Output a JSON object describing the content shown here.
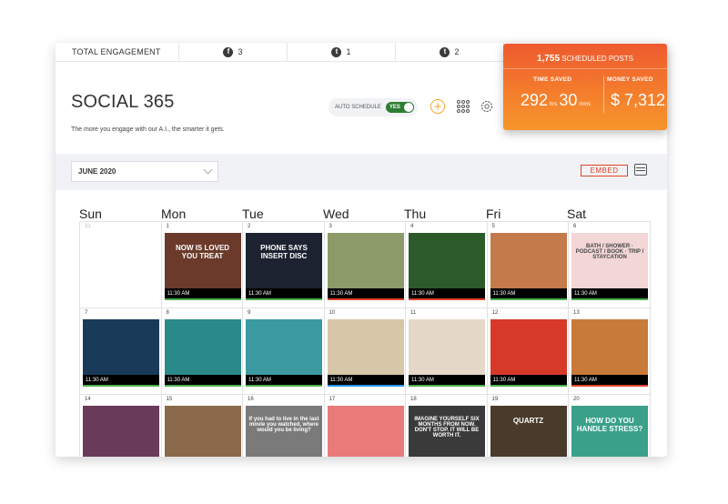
{
  "stats": {
    "label": "TOTAL ENGAGEMENT",
    "networks": [
      {
        "icon": "facebook-icon",
        "glyph": "f",
        "count": "3"
      },
      {
        "icon": "twitter-icon",
        "glyph": "t",
        "count": "1"
      },
      {
        "icon": "tumblr-icon",
        "glyph": "t",
        "count": "2"
      }
    ]
  },
  "header": {
    "title": "SOCIAL 365",
    "subtitle": "The more you engage with our A.I., the smarter it gets.",
    "auto_schedule_label": "AUTO SCHEDULE",
    "toggle_value": "YES",
    "add_glyph": "+"
  },
  "summary": {
    "scheduled_count": "1,755",
    "scheduled_label": "SCHEDULED POSTS",
    "time_saved_label": "TIME SAVED",
    "money_saved_label": "MONEY SAVED",
    "hours": "292",
    "hrs_unit": "hrs",
    "minutes": "30",
    "mins_unit": "mins",
    "money": "$ 7,312"
  },
  "filter": {
    "month": "JUNE 2020",
    "embed_label": "EMBED"
  },
  "calendar": {
    "days": [
      "Sun",
      "Mon",
      "Tue",
      "Wed",
      "Thu",
      "Fri",
      "Sat"
    ],
    "cells": [
      {
        "date": "31",
        "muted": true
      },
      {
        "date": "1",
        "time": "11:30 AM",
        "bg": "#6b3a2a",
        "line": "#4caf50",
        "text": "NOW IS LOVED YOU TREAT"
      },
      {
        "date": "2",
        "time": "11:30 AM",
        "bg": "#1c2230",
        "line": "#4caf50",
        "text": "PHONE SAYS INSERT DISC"
      },
      {
        "date": "3",
        "time": "11:30 AM",
        "bg": "#8c9a6a",
        "line": "#e0432b"
      },
      {
        "date": "4",
        "time": "11:30 AM",
        "bg": "#2d5a2a",
        "line": "#e0432b"
      },
      {
        "date": "5",
        "time": "11:30 AM",
        "bg": "#c47a4a",
        "line": "#4caf50"
      },
      {
        "date": "6",
        "time": "11:30 AM",
        "bg": "#f3d6d6",
        "line": "#4caf50",
        "text": "BATH / SHOWER · PODCAST / BOOK · TRIP / STAYCATION"
      },
      {
        "date": "7",
        "time": "11:30 AM",
        "bg": "#1a3a5a",
        "line": "#4caf50"
      },
      {
        "date": "8",
        "time": "11:30 AM",
        "bg": "#2a8a8a",
        "line": "#4caf50"
      },
      {
        "date": "9",
        "time": "11:30 AM",
        "bg": "#3a9aa0",
        "line": "#4caf50"
      },
      {
        "date": "10",
        "time": "11:30 AM",
        "bg": "#d8c6a8",
        "line": "#2196f3"
      },
      {
        "date": "11",
        "time": "11:30 AM",
        "bg": "#e6d8c8",
        "line": "#4caf50"
      },
      {
        "date": "12",
        "time": "11:30 AM",
        "bg": "#d83a2a",
        "line": "#4caf50"
      },
      {
        "date": "13",
        "time": "11:30 AM",
        "bg": "#c87a3a",
        "line": "#e0432b"
      },
      {
        "date": "14",
        "bg": "#6a3a5a"
      },
      {
        "date": "15",
        "bg": "#8a6a4a"
      },
      {
        "date": "16",
        "bg": "#7a7a7a",
        "text": "If you had to live in the last movie you watched, where would you be living?"
      },
      {
        "date": "17",
        "bg": "#e87a7a"
      },
      {
        "date": "18",
        "bg": "#3a3a3a",
        "text": "IMAGINE YOURSELF SIX MONTHS FROM NOW. DON'T STOP. IT WILL BE WORTH IT."
      },
      {
        "date": "19",
        "bg": "#4a3a2a",
        "text": "QUARTZ"
      },
      {
        "date": "20",
        "bg": "#3aa08a",
        "text": "HOW DO YOU HANDLE STRESS?"
      }
    ]
  }
}
